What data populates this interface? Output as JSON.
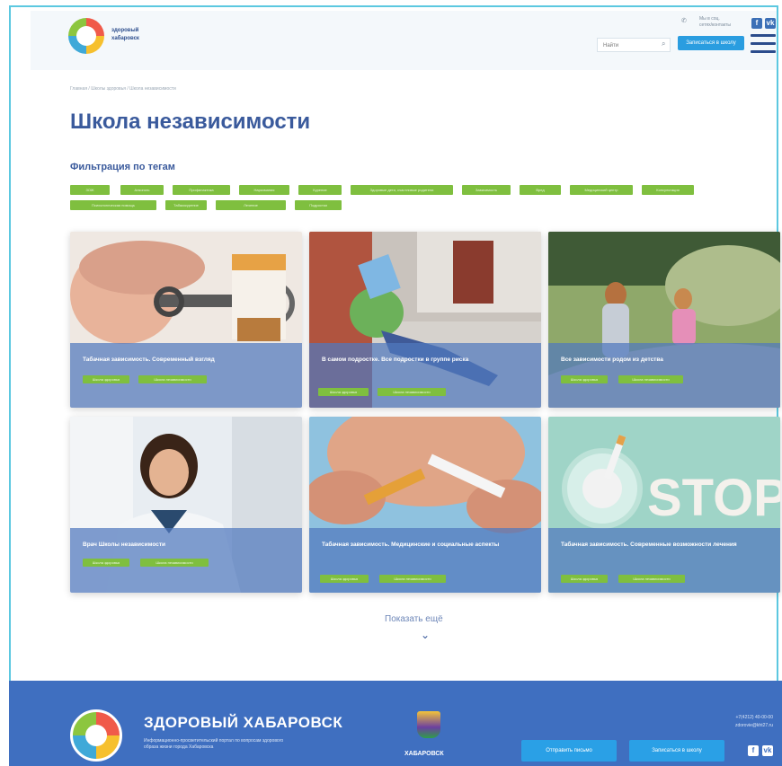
{
  "header": {
    "logo_text_line1": "здоровый",
    "logo_text_line2": "хабаровск",
    "phone_text_line1": "Мы в соц.",
    "phone_text_line2": "сетях/контакты",
    "search_placeholder": "Найти",
    "action_button": "Записаться в школу",
    "social": [
      "f",
      "vk"
    ]
  },
  "breadcrumbs": "Главная / Школы здоровья / Школа независимости",
  "page_title": "Школа независимости",
  "filter_title": "Фильтрация по тегам",
  "tags": [
    "ЗОЖ",
    "Алкоголь",
    "Профилактика",
    "Наркомания",
    "Курение",
    "Здоровые дети, счастливые родители",
    "Зависимость",
    "Вред",
    "Медицинский центр",
    "Консультация",
    "Психологическая помощь",
    "Табакокурение",
    "Лечение",
    "Подростки"
  ],
  "cards": [
    {
      "title": "Табачная зависимость. Современный взгляд",
      "tags": [
        "Школа здоровья",
        "Школа независимости"
      ],
      "image": "cigarettes-handcuffs"
    },
    {
      "title": "В самом подростке. Все подростки в группе риска",
      "tags": [
        "Школа здоровья",
        "Школа независимости"
      ],
      "image": "teen-by-wall"
    },
    {
      "title": "Все зависимости родом из детства",
      "tags": [
        "Школа здоровья",
        "Школа независимости"
      ],
      "image": "children-walking"
    },
    {
      "title": "Врач Школы независимости",
      "tags": [
        "Школа здоровья",
        "Школа независимости"
      ],
      "image": "doctor-portrait"
    },
    {
      "title": "Табачная зависимость. Медицинские и социальные аспекты",
      "tags": [
        "Школа здоровья",
        "Школа независимости"
      ],
      "image": "breaking-cigarette"
    },
    {
      "title": "Табачная зависимость. Современные возможности лечения",
      "tags": [
        "Школа здоровья",
        "Школа независимости"
      ],
      "image": "stop-smoking"
    }
  ],
  "show_more": "Показать ещё",
  "footer": {
    "title": "ЗДОРОВЫЙ ХАБАРОВСК",
    "description": "Информационно-просветительский портал по вопросам здорового образа жизни города Хабаровска",
    "city": "ХАБАРОВСК",
    "contact_phone": "+7(4212) 40-00-00",
    "contact_email": "zdorovie@kht27.ru",
    "button_left": "Отправить письмо",
    "button_right": "Записаться в школу",
    "social": [
      "f",
      "vk"
    ]
  },
  "colors": {
    "accent": "#3a5a9c",
    "tag_green": "#7fbf3f",
    "footer_blue": "#3f6fc0",
    "button_blue": "#2aa0e6"
  }
}
